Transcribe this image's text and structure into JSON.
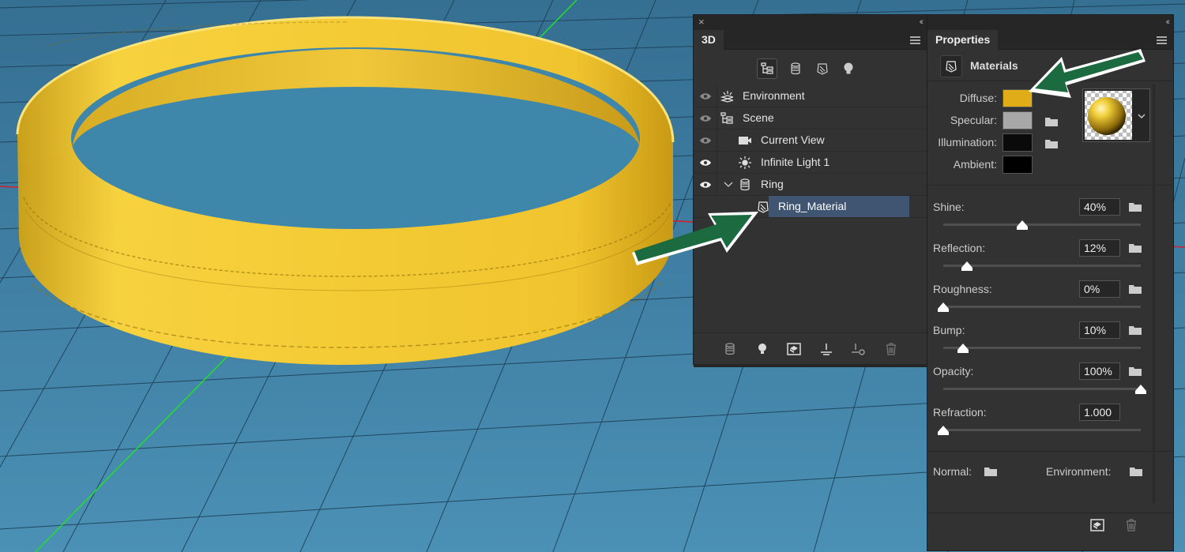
{
  "panel3d": {
    "tab": "3D",
    "layers": [
      {
        "label": "Environment",
        "icon": "environment-icon",
        "visible": true
      },
      {
        "label": "Scene",
        "icon": "scene-icon",
        "visible": true
      },
      {
        "label": "Current View",
        "icon": "camera-icon",
        "visible": true
      },
      {
        "label": "Infinite Light 1",
        "icon": "light-icon",
        "visible": true
      },
      {
        "label": "Ring",
        "icon": "mesh-icon",
        "visible": true
      },
      {
        "label": "Ring_Material",
        "icon": "material-icon",
        "selected": true
      }
    ]
  },
  "properties": {
    "tab": "Properties",
    "section": "Materials",
    "colors": [
      {
        "label": "Diffuse:",
        "color": "#e0ac18"
      },
      {
        "label": "Specular:",
        "color": "#a8a8a8"
      },
      {
        "label": "Illumination:",
        "color": "#0a0a0a"
      },
      {
        "label": "Ambient:",
        "color": "#000000"
      }
    ],
    "sliders": [
      {
        "label": "Shine:",
        "value": "40%",
        "level": 0.4
      },
      {
        "label": "Reflection:",
        "value": "12%",
        "level": 0.12
      },
      {
        "label": "Roughness:",
        "value": "0%",
        "level": 0.0
      },
      {
        "label": "Bump:",
        "value": "10%",
        "level": 0.1
      },
      {
        "label": "Opacity:",
        "value": "100%",
        "level": 1.0
      },
      {
        "label": "Refraction:",
        "value": "1.000",
        "level": 0.0
      }
    ],
    "normal_label": "Normal:",
    "environment_label": "Environment:"
  },
  "colors": {
    "panel": "#323232",
    "selection": "#3f5572",
    "ring_gold": "#f2c72c",
    "ground": "#3d7fa3",
    "arrow": "#1c6b40"
  }
}
